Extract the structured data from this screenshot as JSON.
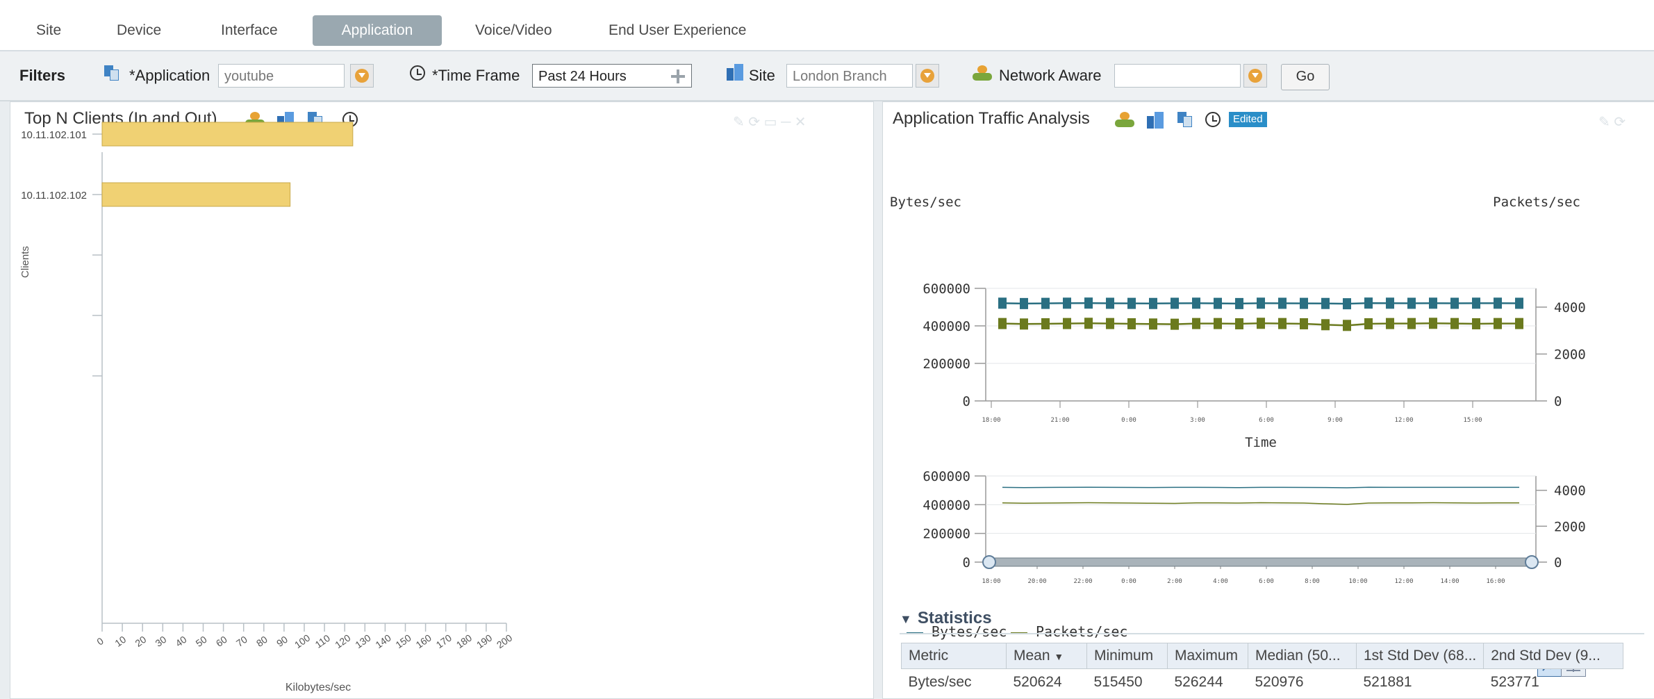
{
  "tabs": [
    {
      "label": "Site",
      "active": false
    },
    {
      "label": "Device",
      "active": false
    },
    {
      "label": "Interface",
      "active": false
    },
    {
      "label": "Application",
      "active": true
    },
    {
      "label": "Voice/Video",
      "active": false
    },
    {
      "label": "End User Experience",
      "active": false
    }
  ],
  "filters": {
    "title": "Filters",
    "application": {
      "label": "*Application",
      "value": "youtube"
    },
    "time_frame": {
      "label": "*Time Frame",
      "value": "Past 24 Hours"
    },
    "site": {
      "label": "Site",
      "value": "London Branch"
    },
    "network_aware": {
      "label": "Network Aware",
      "value": ""
    },
    "go_label": "Go"
  },
  "left_panel": {
    "title": "Top N Clients (In and Out)",
    "chart_data": {
      "type": "bar",
      "orientation": "horizontal",
      "categories": [
        "10.11.102.101",
        "10.11.102.102"
      ],
      "values": [
        124,
        93
      ],
      "xlabel": "Kilobytes/sec",
      "ylabel": "Clients",
      "xlim": [
        0,
        200
      ],
      "xticks": [
        "0",
        "10",
        "20",
        "30",
        "40",
        "50",
        "60",
        "70",
        "80",
        "90",
        "100",
        "110",
        "120",
        "130",
        "140",
        "150",
        "160",
        "170",
        "180",
        "190",
        "200"
      ],
      "bar_color": "#f0d173"
    }
  },
  "right_panel": {
    "title": "Application Traffic Analysis",
    "badge": "Edited",
    "chart_data": {
      "type": "line",
      "left_axis_label": "Bytes/sec",
      "right_axis_label": "Packets/sec",
      "xlabel": "Time",
      "left_ylim": [
        0,
        600000
      ],
      "left_yticks": [
        "0",
        "200000",
        "400000",
        "600000"
      ],
      "right_ylim": [
        0,
        4800
      ],
      "right_yticks": [
        "0",
        "2000",
        "4000"
      ],
      "x_ticks": [
        "18:00",
        "21:00",
        "0:00",
        "3:00",
        "6:00",
        "9:00",
        "12:00",
        "15:00"
      ],
      "overview_x_ticks": [
        "18:00",
        "20:00",
        "22:00",
        "0:00",
        "2:00",
        "4:00",
        "6:00",
        "8:00",
        "10:00",
        "12:00",
        "14:00",
        "16:00"
      ],
      "series": [
        {
          "name": "Bytes/sec",
          "axis": "left",
          "color": "#2a6f82",
          "values": [
            521000,
            519000,
            520000,
            521000,
            521500,
            520500,
            520000,
            519500,
            520500,
            521000,
            520000,
            519000,
            521000,
            520500,
            520000,
            519500,
            518000,
            521500,
            521000,
            520500,
            521000,
            520500,
            521000,
            521000,
            520500
          ]
        },
        {
          "name": "Packets/sec",
          "axis": "right",
          "color": "#6b7a1e",
          "values": [
            3300,
            3280,
            3290,
            3300,
            3310,
            3300,
            3290,
            3280,
            3270,
            3300,
            3300,
            3290,
            3310,
            3300,
            3290,
            3250,
            3220,
            3290,
            3300,
            3300,
            3310,
            3300,
            3290,
            3300,
            3300
          ]
        }
      ]
    },
    "legend": [
      "Bytes/sec",
      "Packets/sec"
    ],
    "statistics": {
      "title": "Statistics",
      "headers": [
        "Metric",
        "Mean",
        "Minimum",
        "Maximum",
        "Median (50...",
        "1st Std Dev (68...",
        "2nd Std Dev (9..."
      ],
      "rows": [
        [
          "Bytes/sec",
          "520624",
          "515450",
          "526244",
          "520976",
          "521881",
          "523771"
        ]
      ]
    }
  }
}
